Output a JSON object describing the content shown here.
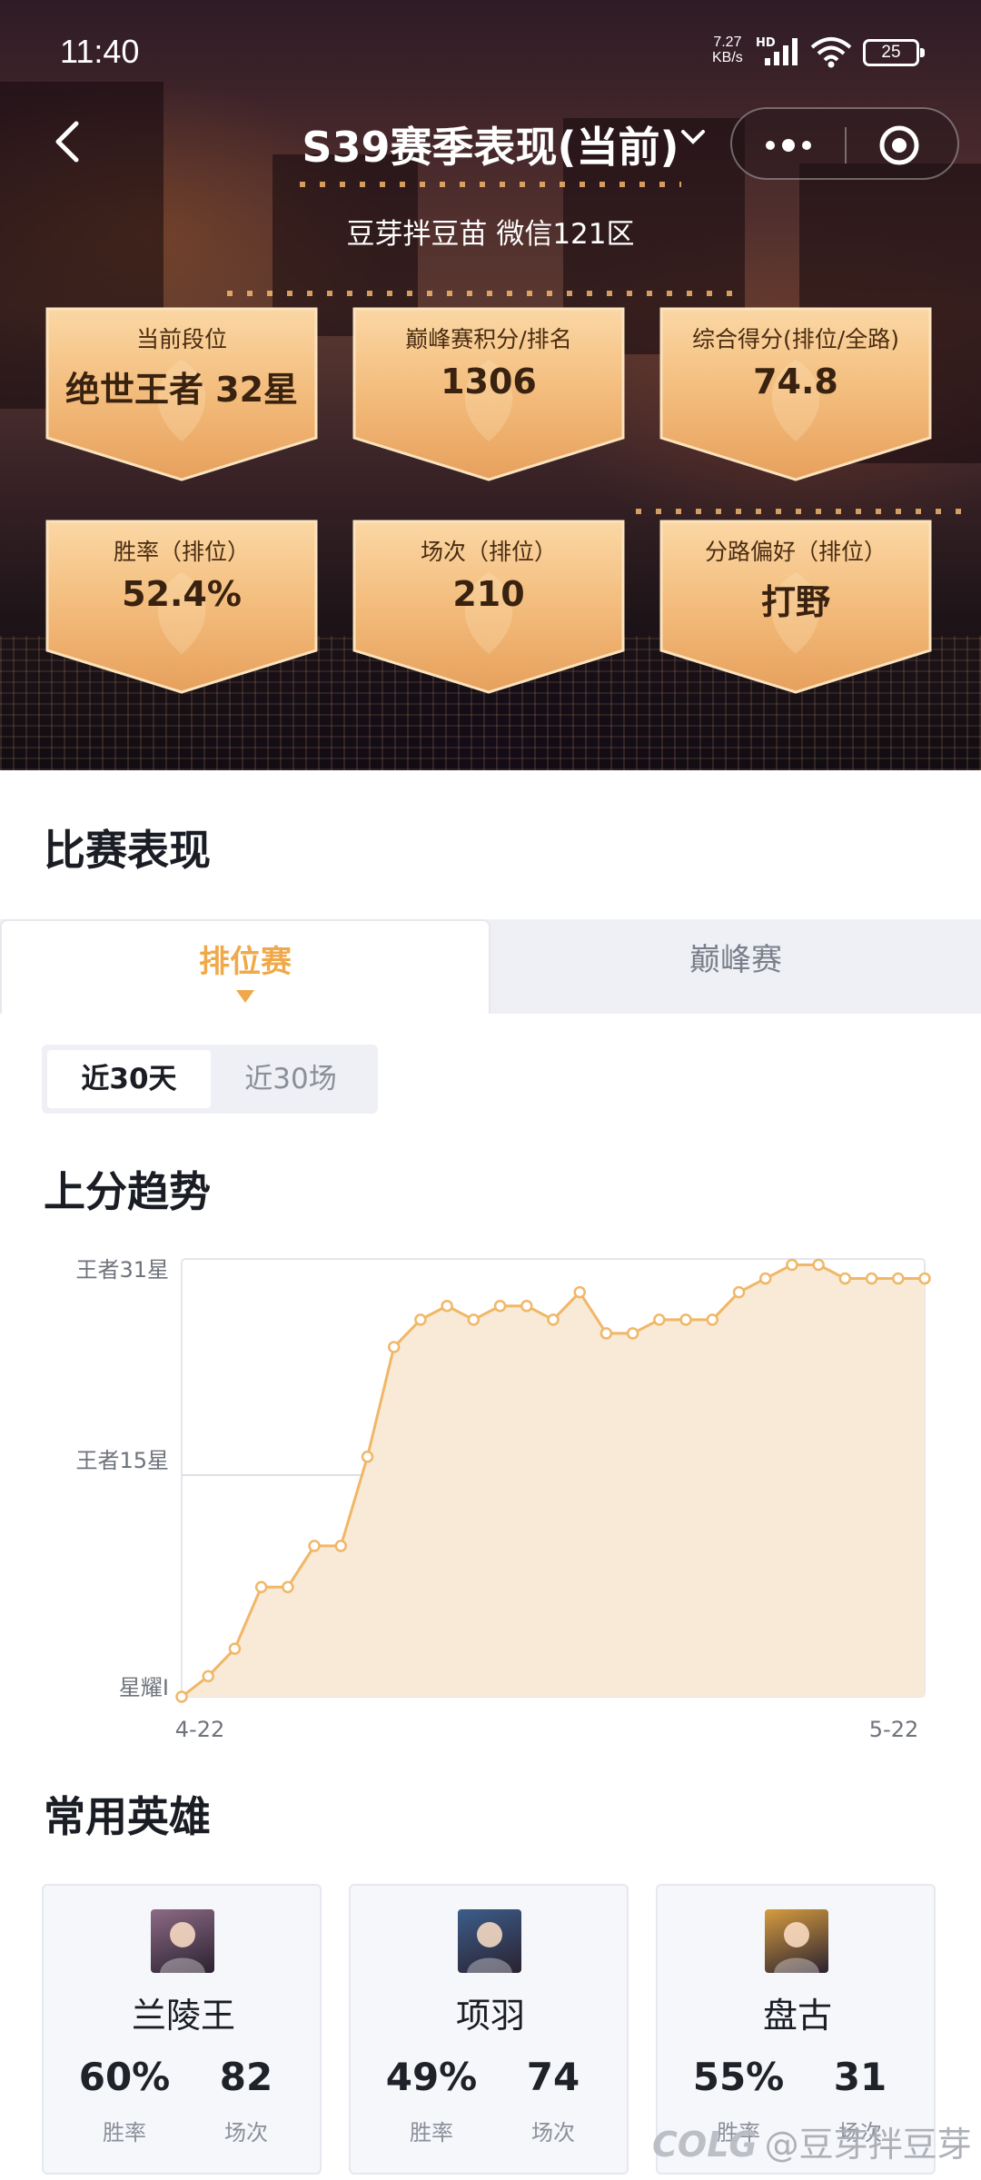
{
  "status_bar": {
    "time": "11:40",
    "net_speed_value": "7.27",
    "net_speed_unit": "KB/s",
    "hd_label": "HD",
    "battery": "25"
  },
  "header": {
    "title": "S39赛季表现(当前)",
    "subtitle": "豆芽拌豆苗 微信121区"
  },
  "stats": [
    {
      "label": "当前段位",
      "value": "绝世王者 32星"
    },
    {
      "label": "巅峰赛积分/排名",
      "value": "1306"
    },
    {
      "label": "综合得分(排位/全路)",
      "value": "74.8"
    },
    {
      "label": "胜率（排位）",
      "value": "52.4%"
    },
    {
      "label": "场次（排位）",
      "value": "210"
    },
    {
      "label": "分路偏好（排位）",
      "value": "打野"
    }
  ],
  "performance": {
    "title": "比赛表现",
    "tabs": [
      "排位赛",
      "巅峰赛"
    ],
    "active_tab": "排位赛",
    "ranges": [
      "近30天",
      "近30场"
    ],
    "active_range": "近30天"
  },
  "trend": {
    "title": "上分趋势"
  },
  "chart_data": {
    "type": "area",
    "title": "上分趋势",
    "xlabel": "",
    "ylabel": "",
    "y_tick_labels": [
      "星耀I",
      "王者15星",
      "王者31星"
    ],
    "x_tick_labels": [
      "4-22",
      "5-22"
    ],
    "grid": true,
    "color": "#f0b768",
    "fill": "#f8ead6",
    "series": [
      {
        "values": [
          0,
          3,
          7,
          16,
          16,
          22,
          22,
          35,
          51,
          55,
          57,
          55,
          57,
          57,
          55,
          59,
          53,
          53,
          55,
          55,
          55,
          59,
          61,
          63,
          63,
          61,
          61,
          61,
          61
        ]
      }
    ],
    "ylim": [
      0,
      62
    ]
  },
  "heroes": {
    "title": "常用英雄",
    "winrate_label": "胜率",
    "games_label": "场次",
    "items": [
      {
        "name": "兰陵王",
        "winrate": "60%",
        "games": "82",
        "avatar_color": "#8d6a86"
      },
      {
        "name": "项羽",
        "winrate": "49%",
        "games": "74",
        "avatar_color": "#3c5d8a"
      },
      {
        "name": "盘古",
        "winrate": "55%",
        "games": "31",
        "avatar_color": "#d79c3f"
      }
    ]
  },
  "watermark": {
    "logo": "COLG",
    "text": "@豆芽拌豆芽"
  }
}
